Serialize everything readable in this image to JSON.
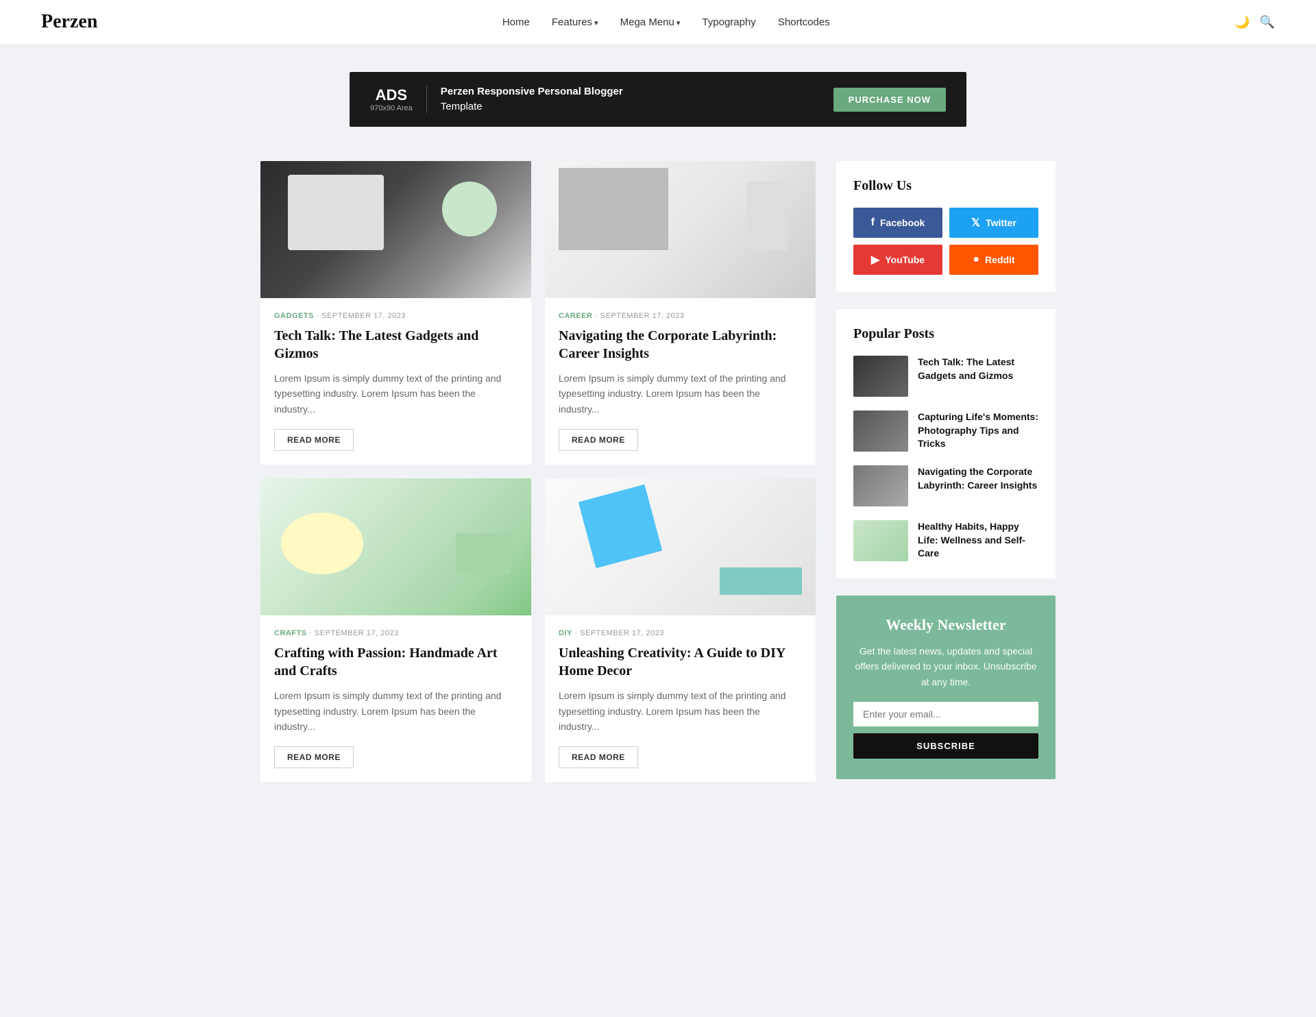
{
  "site": {
    "logo": "Perzen"
  },
  "nav": {
    "home": "Home",
    "features": "Features",
    "mega_menu": "Mega Menu",
    "typography": "Typography",
    "shortcodes": "Shortcodes"
  },
  "banner": {
    "ads_label": "ADS",
    "ads_sub": "970x90 Area",
    "text_line1": "Perzen Responsive Personal Blogger",
    "text_line2": "Template",
    "btn_label": "PURCHASE NOW"
  },
  "articles": [
    {
      "category": "GADGETS",
      "date": "SEPTEMBER 17, 2023",
      "title": "Tech Talk: The Latest Gadgets and Gizmos",
      "excerpt": "Lorem Ipsum is simply dummy text of the printing and typesetting industry. Lorem Ipsum has been the industry...",
      "read_more": "READ MORE",
      "img_type": "gadgets"
    },
    {
      "category": "CAREER",
      "date": "SEPTEMBER 17, 2023",
      "title": "Navigating the Corporate Labyrinth: Career Insights",
      "excerpt": "Lorem Ipsum is simply dummy text of the printing and typesetting industry. Lorem Ipsum has been the industry...",
      "read_more": "READ MORE",
      "img_type": "career"
    },
    {
      "category": "CRAFTS",
      "date": "SEPTEMBER 17, 2023",
      "title": "Crafting with Passion: Handmade Art and Crafts",
      "excerpt": "Lorem Ipsum is simply dummy text of the printing and typesetting industry. Lorem Ipsum has been the industry...",
      "read_more": "READ MORE",
      "img_type": "crafts"
    },
    {
      "category": "DIY",
      "date": "SEPTEMBER 17, 2023",
      "title": "Unleashing Creativity: A Guide to DIY Home Decor",
      "excerpt": "Lorem Ipsum is simply dummy text of the printing and typesetting industry. Lorem Ipsum has been the industry...",
      "read_more": "READ MORE",
      "img_type": "diy"
    }
  ],
  "sidebar": {
    "follow_title": "Follow Us",
    "social": {
      "facebook": "Facebook",
      "twitter": "Twitter",
      "youtube": "YouTube",
      "reddit": "Reddit"
    },
    "popular_title": "Popular Posts",
    "popular_posts": [
      {
        "title": "Tech Talk: The Latest Gadgets and Gizmos",
        "img_type": "gadgets"
      },
      {
        "title": "Capturing Life's Moments: Photography Tips and Tricks",
        "img_type": "photography"
      },
      {
        "title": "Navigating the Corporate Labyrinth: Career Insights",
        "img_type": "career"
      },
      {
        "title": "Healthy Habits, Happy Life: Wellness and Self-Care",
        "img_type": "wellness"
      }
    ],
    "newsletter": {
      "title": "Weekly Newsletter",
      "text": "Get the latest news, updates and special offers delivered to your inbox. Unsubscribe at any time.",
      "input_placeholder": "Enter your email...",
      "btn_label": "SUBSCRIBE"
    }
  }
}
